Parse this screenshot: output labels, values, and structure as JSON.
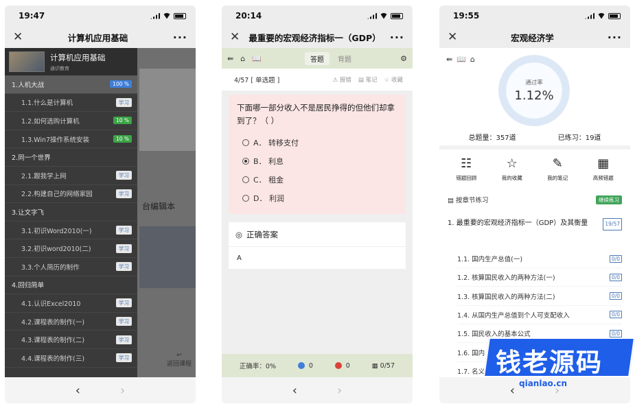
{
  "screen1": {
    "time": "19:47",
    "nav_title": "计算机应用基础",
    "course_title": "计算机应用基础",
    "course_sub": "通识教育",
    "bg_text": "台编辑本",
    "back_label": "返回课程",
    "items": [
      {
        "label": "1.人机大战",
        "kind": "chap",
        "badge": "100 %",
        "badge_type": "blue",
        "active": true
      },
      {
        "label": "1.1.什么是计算机",
        "kind": "sec",
        "badge": "学习",
        "badge_type": "plain"
      },
      {
        "label": "1.2.如何选购计算机",
        "kind": "sec",
        "badge": "10 %",
        "badge_type": "green"
      },
      {
        "label": "1.3.Win7操作系统安装",
        "kind": "sec",
        "badge": "10 %",
        "badge_type": "green"
      },
      {
        "label": "2.同一个世界",
        "kind": "chap",
        "badge": "",
        "badge_type": ""
      },
      {
        "label": "2.1.跟我学上网",
        "kind": "sec",
        "badge": "学习",
        "badge_type": "plain"
      },
      {
        "label": "2.2.构建自己的网络家园",
        "kind": "sec",
        "badge": "学习",
        "badge_type": "plain"
      },
      {
        "label": "3.让文字飞",
        "kind": "chap",
        "badge": "",
        "badge_type": ""
      },
      {
        "label": "3.1.初识Word2010(一)",
        "kind": "sec",
        "badge": "学习",
        "badge_type": "plain"
      },
      {
        "label": "3.2.初识word2010(二)",
        "kind": "sec",
        "badge": "学习",
        "badge_type": "plain"
      },
      {
        "label": "3.3.个人简历的制作",
        "kind": "sec",
        "badge": "学习",
        "badge_type": "plain"
      },
      {
        "label": "4.回归简单",
        "kind": "chap",
        "badge": "",
        "badge_type": ""
      },
      {
        "label": "4.1.认识Excel2010",
        "kind": "sec",
        "badge": "学习",
        "badge_type": "plain"
      },
      {
        "label": "4.2.课程表的制作(一)",
        "kind": "sec",
        "badge": "学习",
        "badge_type": "plain"
      },
      {
        "label": "4.3.课程表的制作(二)",
        "kind": "sec",
        "badge": "学习",
        "badge_type": "plain"
      },
      {
        "label": "4.4.课程表的制作(三)",
        "kind": "sec",
        "badge": "学习",
        "badge_type": "plain"
      }
    ]
  },
  "screen2": {
    "time": "20:14",
    "nav_title": "最重要的宏观经济指标一（GDP）",
    "tab_answer": "答题",
    "tab_recite": "背题",
    "progress": "4/57",
    "qtype": "[ 单选题 ]",
    "act_report": "报错",
    "act_note": "笔记",
    "act_fav": "收藏",
    "question": "下面哪一部分收入不是居民挣得的但他们却拿到了？（ ）",
    "options": [
      {
        "label": "A．  转移支付",
        "selected": false
      },
      {
        "label": "B．  利息",
        "selected": true
      },
      {
        "label": "C．  租金",
        "selected": false
      },
      {
        "label": "D．  利润",
        "selected": false
      }
    ],
    "answer_title": "正确答案",
    "answer_value": "A",
    "footer": {
      "accuracy": "正确率：0%",
      "correct": "0",
      "wrong": "0",
      "count": "0/57"
    }
  },
  "screen3": {
    "time": "19:55",
    "nav_title": "宏观经济学",
    "rate_label": "通过率",
    "rate_value": "1.12%",
    "total": "总题量：357道",
    "practiced": "已练习：19道",
    "quick": [
      {
        "label": "错题回顾",
        "icon": "list-icon"
      },
      {
        "label": "我的收藏",
        "icon": "star-icon"
      },
      {
        "label": "我的笔记",
        "icon": "pen-icon"
      },
      {
        "label": "高频错题",
        "icon": "doc-icon"
      }
    ],
    "chapter_practice": "按章节练习",
    "continue_label": "继续练习",
    "chapter1": "1.   最重要的宏观经济指标一（GDP）及其衡量",
    "chapter1_frac": "19/57",
    "sections": [
      {
        "label": "1.1. 国内生产总值(一)",
        "frac": "0/0"
      },
      {
        "label": "1.2. 核算国民收入的两种方法(一)",
        "frac": "0/0"
      },
      {
        "label": "1.3. 核算国民收入的两种方法(二)",
        "frac": "0/0"
      },
      {
        "label": "1.4. 从国内生产总值到个人可支配收入",
        "frac": "0/0"
      },
      {
        "label": "1.5. 国民收入的基本公式",
        "frac": "0/0"
      },
      {
        "label": "1.6. 国内",
        "frac": ""
      },
      {
        "label": "1.7. 名义",
        "frac": ""
      }
    ]
  },
  "watermark": {
    "text": "钱老源码",
    "url": "qianlao.cn"
  },
  "colors": {
    "accent_blue": "#1f5ee8",
    "green_toolbar": "#dfe7d3",
    "question_bg": "#fbe6e5"
  }
}
